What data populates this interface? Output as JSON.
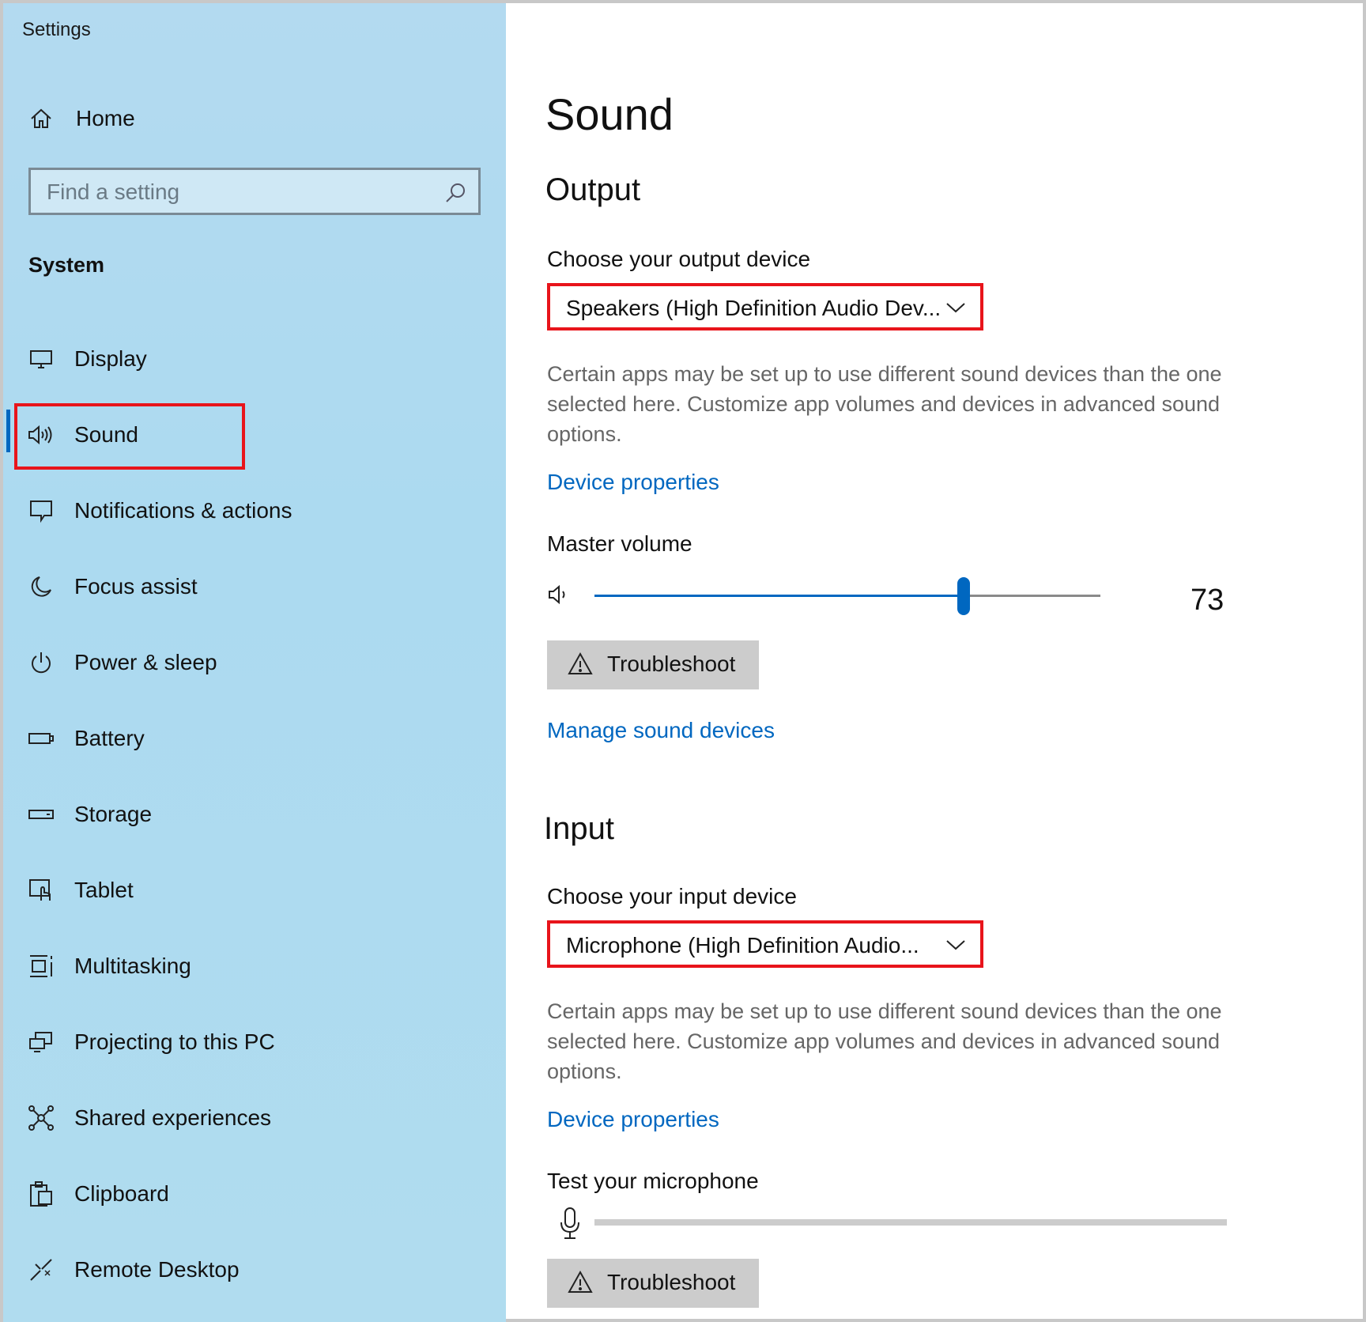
{
  "app": {
    "title": "Settings"
  },
  "sidebar": {
    "home_label": "Home",
    "search_placeholder": "Find a setting",
    "section": "System",
    "items": [
      {
        "label": "Display",
        "icon": "display-icon"
      },
      {
        "label": "Sound",
        "icon": "speaker-icon",
        "selected": true
      },
      {
        "label": "Notifications & actions",
        "icon": "notification-icon"
      },
      {
        "label": "Focus assist",
        "icon": "moon-icon"
      },
      {
        "label": "Power & sleep",
        "icon": "power-icon"
      },
      {
        "label": "Battery",
        "icon": "battery-icon"
      },
      {
        "label": "Storage",
        "icon": "storage-icon"
      },
      {
        "label": "Tablet",
        "icon": "tablet-icon"
      },
      {
        "label": "Multitasking",
        "icon": "multitasking-icon"
      },
      {
        "label": "Projecting to this PC",
        "icon": "projecting-icon"
      },
      {
        "label": "Shared experiences",
        "icon": "shared-icon"
      },
      {
        "label": "Clipboard",
        "icon": "clipboard-icon"
      },
      {
        "label": "Remote Desktop",
        "icon": "remote-desktop-icon"
      }
    ]
  },
  "main": {
    "title": "Sound",
    "output": {
      "heading": "Output",
      "device_label": "Choose your output device",
      "device_value": "Speakers (High Definition Audio Dev...",
      "description": "Certain apps may be set up to use different sound devices than the one selected here. Customize app volumes and devices in advanced sound options.",
      "device_properties_link": "Device properties",
      "volume_label": "Master volume",
      "volume_value": "73",
      "volume_fraction": 0.73,
      "troubleshoot_label": "Troubleshoot",
      "manage_link": "Manage sound devices"
    },
    "input": {
      "heading": "Input",
      "device_label": "Choose your input device",
      "device_value": "Microphone (High Definition Audio...",
      "description": "Certain apps may be set up to use different sound devices than the one selected here. Customize app volumes and devices in advanced sound options.",
      "device_properties_link": "Device properties",
      "test_label": "Test your microphone",
      "mic_level_fraction": 0,
      "troubleshoot_label": "Troubleshoot"
    }
  },
  "colors": {
    "accent": "#0067c0",
    "highlight": "#e8141b",
    "sidebar_bg": "#acdaf0"
  }
}
